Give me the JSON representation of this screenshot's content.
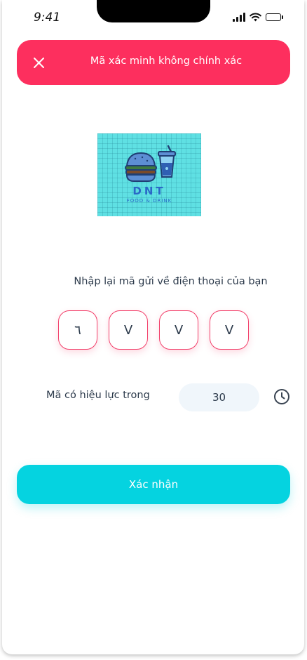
{
  "status_bar": {
    "time": "9:41"
  },
  "error_banner": {
    "message": "Mã xác minh không chính xác",
    "close_icon": "close-icon",
    "color": "#fd2f5e"
  },
  "logo": {
    "brand": "DNT",
    "tagline": "FOOD & DRINK"
  },
  "instruction": "Nhập lại mã gửi về điện thoại của bạn",
  "otp": [
    "٦",
    "V",
    "V",
    "V"
  ],
  "validity": {
    "label": "Mã có hiệu lực trong",
    "seconds": "30",
    "icon": "clock-icon"
  },
  "confirm_button": {
    "label": "Xác nhận",
    "color": "#05d3e0"
  }
}
